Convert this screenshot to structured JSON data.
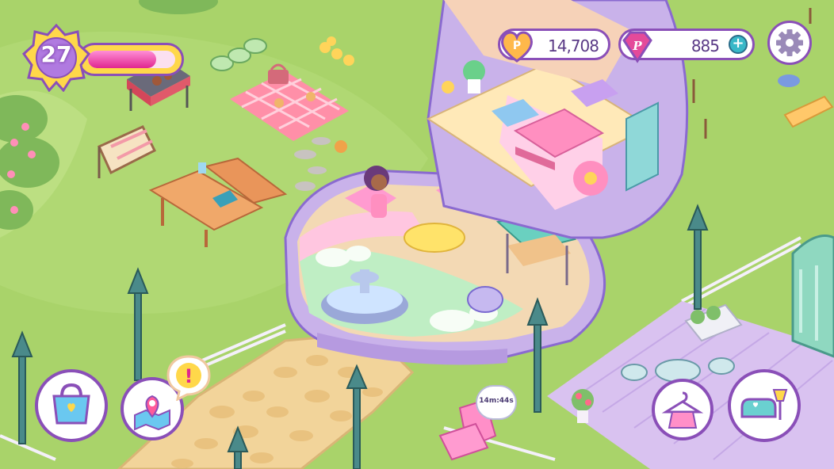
{
  "hud": {
    "level": "27",
    "xp_progress": 0.78,
    "coins": "14,708",
    "gems": "885",
    "add_gems_symbol": "+",
    "timer": "14m:44s",
    "alert_symbol": "!"
  },
  "icons": {
    "level": "level-star-badge-icon",
    "coin": "heart-coin-icon",
    "gem": "pink-gem-icon",
    "settings": "gear-icon",
    "shop": "shopping-bag-icon",
    "map": "map-pin-icon",
    "alert": "exclamation-icon",
    "wardrobe": "clothes-hanger-icon",
    "furniture": "sofa-lamp-icon"
  },
  "colors": {
    "grass": "#a9d36a",
    "grass_dark": "#97c45c",
    "accent_purple": "#8a4fb8",
    "xp_pink": "#e0268f",
    "gold": "#ffd84a",
    "pod_lavender": "#c9b2ea"
  }
}
